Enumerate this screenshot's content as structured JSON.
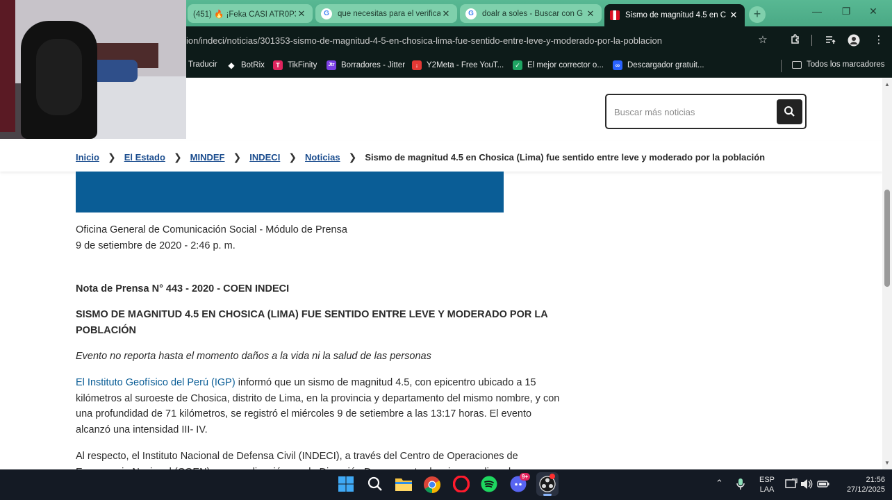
{
  "browser": {
    "tabs": [
      {
        "label": "(451) 🔥 ¡Feka CASI ATR0P3",
        "favicon": "youtube-icon",
        "close": "✕"
      },
      {
        "label": "que necesitas para el verifica",
        "favicon": "google-icon",
        "close": "✕"
      },
      {
        "label": "doalr a soles - Buscar con G",
        "favicon": "google-icon",
        "close": "✕"
      },
      {
        "label": "Sismo de magnitud 4.5 en C",
        "favicon": "peru-flag-icon",
        "close": "✕"
      }
    ],
    "new_tab": "+",
    "window_controls": {
      "minimize": "—",
      "maximize": "❐",
      "close": "✕"
    },
    "url": "ion/indeci/noticias/301353-sismo-de-magnitud-4-5-en-chosica-lima-fue-sentido-entre-leve-y-moderado-por-la-poblacion",
    "bookmarks": [
      {
        "label": "Traducir",
        "icon": "translate-icon"
      },
      {
        "label": "BotRix",
        "icon": "botrix-icon"
      },
      {
        "label": "TikFinity",
        "icon": "tikfinity-icon"
      },
      {
        "label": "Borradores - Jitter",
        "icon": "jitter-icon"
      },
      {
        "label": "Y2Meta - Free YouT...",
        "icon": "y2meta-icon"
      },
      {
        "label": "El mejor corrector o...",
        "icon": "corrector-icon"
      },
      {
        "label": "Descargador gratuit...",
        "icon": "download-icon"
      }
    ],
    "all_bookmarks": "Todos los marcadores",
    "accent_color": "#4fae8a"
  },
  "page": {
    "search_placeholder": "Buscar más noticias",
    "breadcrumb": {
      "items": [
        "Inicio",
        "El Estado",
        "MINDEF",
        "INDECI",
        "Noticias"
      ],
      "current": "Sismo de magnitud 4.5 en Chosica (Lima) fue sentido entre leve y moderado por la población"
    },
    "article": {
      "author": "Oficina General de Comunicación Social - Módulo de Prensa",
      "date": "9 de setiembre de 2020 - 2:46 p. m.",
      "press_note": "Nota de Prensa N° 443 - 2020 - COEN INDECI",
      "headline": "SISMO DE MAGNITUD 4.5 EN CHOSICA (LIMA) FUE SENTIDO ENTRE LEVE Y MODERADO POR LA POBLACIÓN",
      "subtitle": "Evento no reporta hasta el momento daños a la vida ni la salud de las personas",
      "p1_link": "El Instituto Geofísico del Perú (IGP)",
      "p1_rest": " informó que un sismo de magnitud 4.5, con epicentro ubicado a 15 kilómetros al suroeste de Chosica, distrito de Lima, en la provincia y departamento del mismo nombre, y con una profundidad de 71 kilómetros, se registró el miércoles 9 de setiembre a las 13:17 horas. El evento alcanzó una intensidad III- IV.",
      "p2": "Al respecto, el Instituto Nacional de Defensa Civil (INDECI), a través del Centro de Operaciones de Emergencia Nacional (COEN), en coordinación con la Dirección Desconcentrada, viene realizando acciones"
    }
  },
  "taskbar": {
    "lang_top": "ESP",
    "lang_bottom": "LAA",
    "time": "21:56",
    "date": "27/12/2025",
    "discord_badge": "9+"
  }
}
